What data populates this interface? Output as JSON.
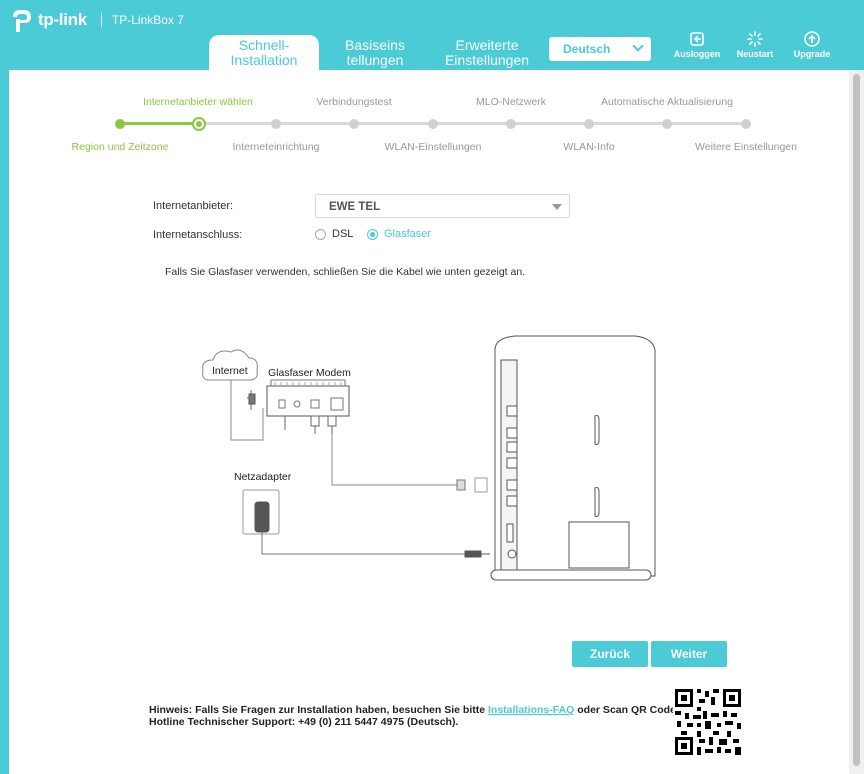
{
  "header": {
    "brand": "tp-link",
    "model": "TP-LinkBox 7",
    "tabs": [
      {
        "line1": "Schnell-",
        "line2": "Installation",
        "active": true
      },
      {
        "line1": "Basiseins",
        "line2": "tellungen",
        "active": false
      },
      {
        "line1": "Erweiterte",
        "line2": "Einstellungen",
        "active": false
      }
    ],
    "language": "Deutsch",
    "actions": {
      "logout": "Ausloggen",
      "reboot": "Neustart",
      "upgrade": "Upgrade"
    },
    "accent_color": "#4acbd6"
  },
  "progress": {
    "done_color": "#8dc63f",
    "current_step": 2,
    "steps": [
      "Region und Zeitzone",
      "Internetanbieter wählen",
      "Interneteinrichtung",
      "Verbindungstest",
      "WLAN-Einstellungen",
      "MLO-Netzwerk",
      "WLAN-Info",
      "Automatische Aktualisierung",
      "Weitere Einstellungen"
    ]
  },
  "form": {
    "provider_label": "Internetanbieter:",
    "provider_value": "EWE TEL",
    "connection_label": "Internetanschluss:",
    "connection_options": [
      {
        "label": "DSL",
        "selected": false
      },
      {
        "label": "Glasfaser",
        "selected": true
      }
    ]
  },
  "instruction": "Falls Sie Glasfaser verwenden, schließen Sie die Kabel wie unten gezeigt an.",
  "diagram": {
    "internet": "Internet",
    "modem": "Glasfaser Modem",
    "adapter": "Netzadapter"
  },
  "buttons": {
    "back": "Zurück",
    "next": "Weiter"
  },
  "footer": {
    "note_prefix": "Hinweis: Falls Sie Fragen zur Installation haben, besuchen Sie bitte",
    "faq_link": "Installations-FAQ",
    "note_suffix": "oder Scan QR Code.",
    "hotline": "Hotline Technischer Support: +49 (0) 211 5447 4975 (Deutsch)."
  }
}
